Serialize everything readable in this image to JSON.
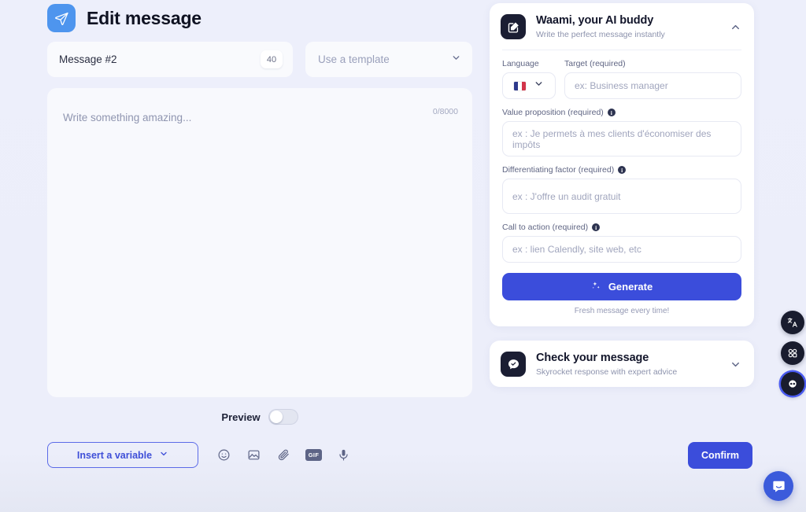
{
  "header": {
    "icon": "send-plane-icon",
    "title": "Edit message"
  },
  "message_meta": {
    "name": "Message #2",
    "char_count": "40",
    "template_placeholder": "Use a template",
    "template_chevron": "chevron-down-icon"
  },
  "editor": {
    "placeholder": "Write something amazing...",
    "counter": "0/8000"
  },
  "preview": {
    "label": "Preview",
    "enabled": false
  },
  "toolbar": {
    "insert_variable_label": "Insert a variable",
    "icons": [
      {
        "name": "emoji-icon",
        "label": "emoji"
      },
      {
        "name": "image-icon",
        "label": "image"
      },
      {
        "name": "attachment-icon",
        "label": "attachment"
      },
      {
        "name": "gif-icon",
        "label": "GIF"
      },
      {
        "name": "microphone-icon",
        "label": "voice note"
      }
    ],
    "confirm_label": "Confirm"
  },
  "ai_card": {
    "icon": "compose-edit-icon",
    "title": "Waami, your AI buddy",
    "subtitle": "Write the perfect message instantly",
    "chevron": "chevron-up-icon",
    "language_label": "Language",
    "language_value": "French",
    "language_chevron": "chevron-down-icon",
    "target_label": "Target (required)",
    "target_placeholder": "ex: Business manager",
    "value_prop_label": "Value proposition (required)",
    "value_prop_placeholder": "ex : Je permets à mes clients d'économiser des impôts",
    "diff_label": "Differentiating factor (required)",
    "diff_placeholder": "ex : J'offre un audit gratuit",
    "cta_label": "Call to action (required)",
    "cta_placeholder": "ex : lien Calendly, site web, etc",
    "info_glyph": "i",
    "generate_label": "Generate",
    "generate_icon": "sparkle-icon",
    "generate_note": "Fresh message every time!"
  },
  "check_card": {
    "icon": "chat-check-icon",
    "title": "Check your message",
    "subtitle": "Skyrocket response with expert advice",
    "chevron": "chevron-down-icon"
  },
  "floating": {
    "buttons": [
      {
        "name": "translate-icon",
        "label": "Translate"
      },
      {
        "name": "apps-grid-icon",
        "label": "Apps"
      },
      {
        "name": "extension-icon",
        "label": "Extension"
      }
    ],
    "chat_launcher": "chat-bubble-icon"
  },
  "colors": {
    "accent": "#3b4ddb",
    "accent_light": "#4e95ee",
    "dark": "#1b1e33",
    "page_bg": "#eceefa"
  }
}
